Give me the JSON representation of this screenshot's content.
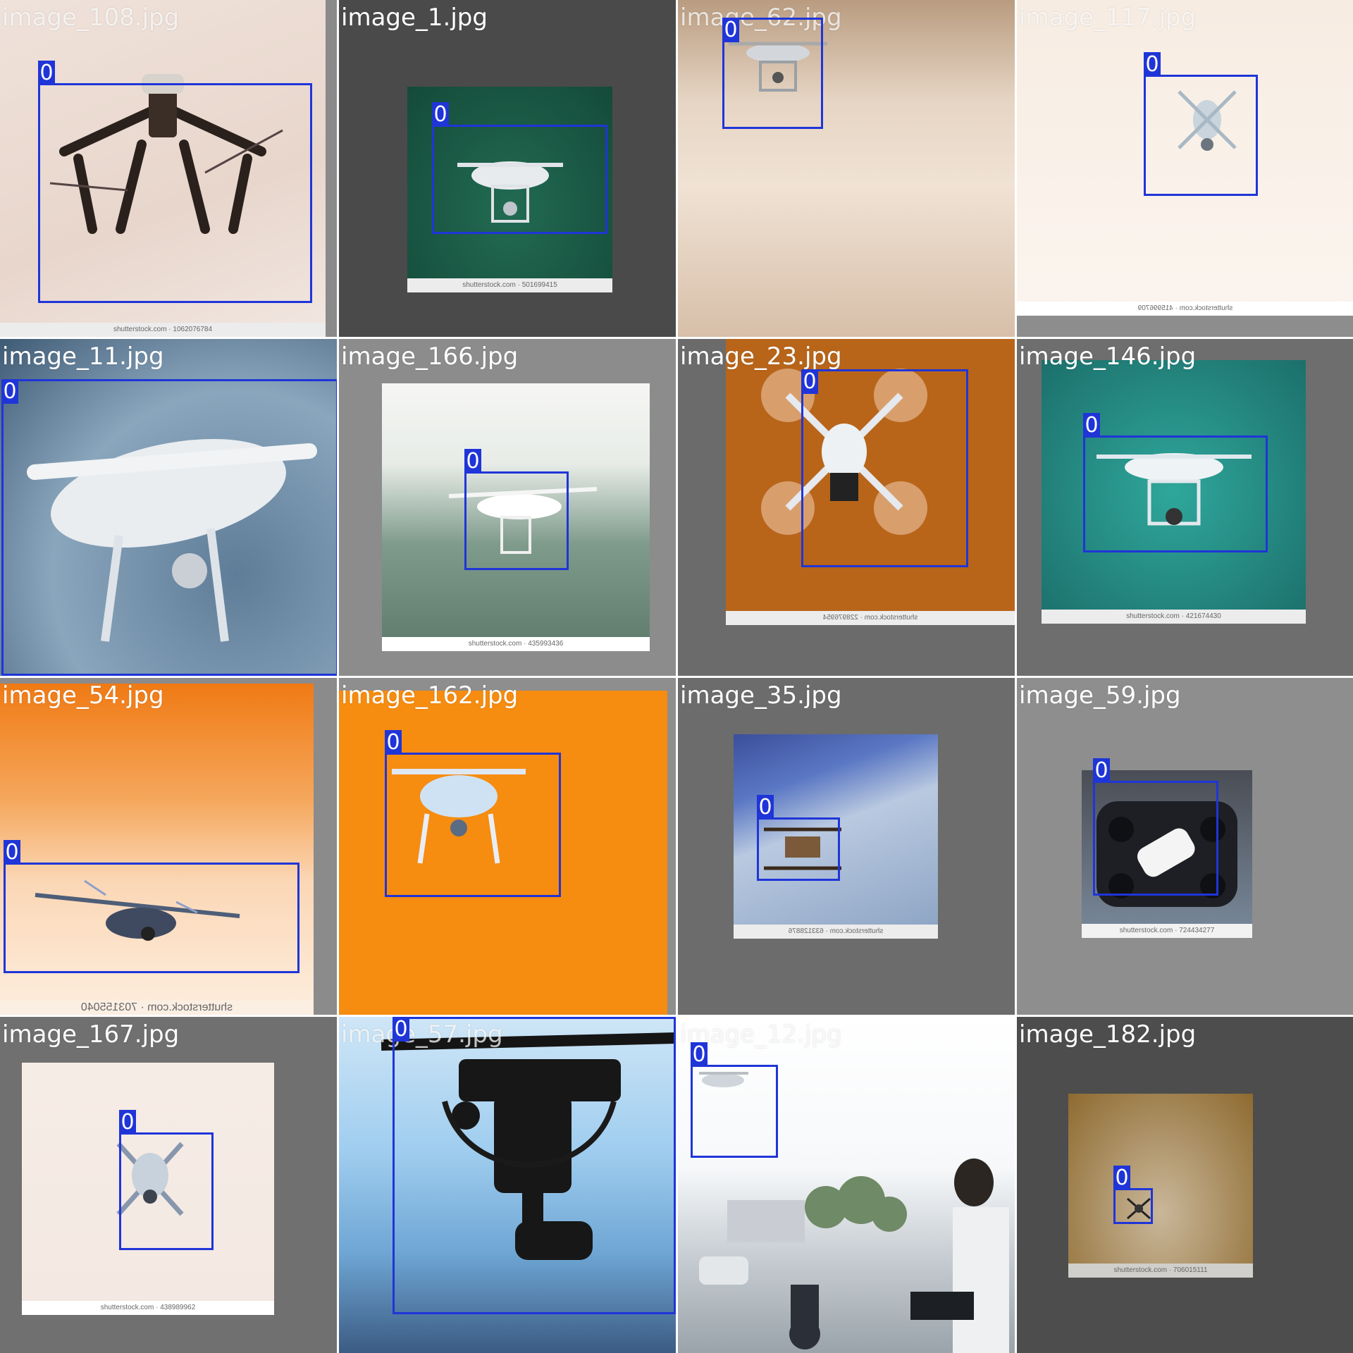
{
  "colors": {
    "box": "#1f35d8",
    "label_text": "#ffffff"
  },
  "tiles": [
    {
      "filename": "image_108.jpg",
      "class_label": "0",
      "watermark": "shutterstock.com · 1062076784",
      "subject": "drone-inspire"
    },
    {
      "filename": "image_1.jpg",
      "class_label": "0",
      "watermark": "shutterstock.com · 501699415",
      "subject": "drone-phantom"
    },
    {
      "filename": "image_62.jpg",
      "class_label": "0",
      "watermark": "",
      "subject": "drone-phantom-small"
    },
    {
      "filename": "image_117.jpg",
      "class_label": "0",
      "watermark": "shutterstock.com · 415996709",
      "subject": "drone-phantom-small"
    },
    {
      "filename": "image_11.jpg",
      "class_label": "0",
      "watermark": "",
      "subject": "drone-phantom-closeup"
    },
    {
      "filename": "image_166.jpg",
      "class_label": "0",
      "watermark": "shutterstock.com · 435993436",
      "subject": "drone-phantom"
    },
    {
      "filename": "image_23.jpg",
      "class_label": "0",
      "watermark": "shutterstock.com · 228976954",
      "subject": "drone-phantom-spinning"
    },
    {
      "filename": "image_146.jpg",
      "class_label": "0",
      "watermark": "shutterstock.com · 421674430",
      "subject": "drone-phantom"
    },
    {
      "filename": "image_54.jpg",
      "class_label": "0",
      "watermark": "shutterstock.com · 703155040",
      "subject": "drone-flying"
    },
    {
      "filename": "image_162.jpg",
      "class_label": "0",
      "watermark": "",
      "subject": "drone-phantom"
    },
    {
      "filename": "image_35.jpg",
      "class_label": "0",
      "watermark": "shutterstock.com · 633128876",
      "subject": "drone-mavic"
    },
    {
      "filename": "image_59.jpg",
      "class_label": "0",
      "watermark": "shutterstock.com · 724434277",
      "subject": "drone-spark-case"
    },
    {
      "filename": "image_167.jpg",
      "class_label": "0",
      "watermark": "shutterstock.com · 438989962",
      "subject": "drone-phantom"
    },
    {
      "filename": "image_57.jpg",
      "class_label": "0",
      "watermark": "",
      "subject": "drone-silhouette"
    },
    {
      "filename": "image_12.jpg",
      "class_label": "0",
      "watermark": "",
      "subject": "drone-street-scene"
    },
    {
      "filename": "image_182.jpg",
      "class_label": "0",
      "watermark": "shutterstock.com · 706015111",
      "subject": "drone-tiny"
    }
  ]
}
